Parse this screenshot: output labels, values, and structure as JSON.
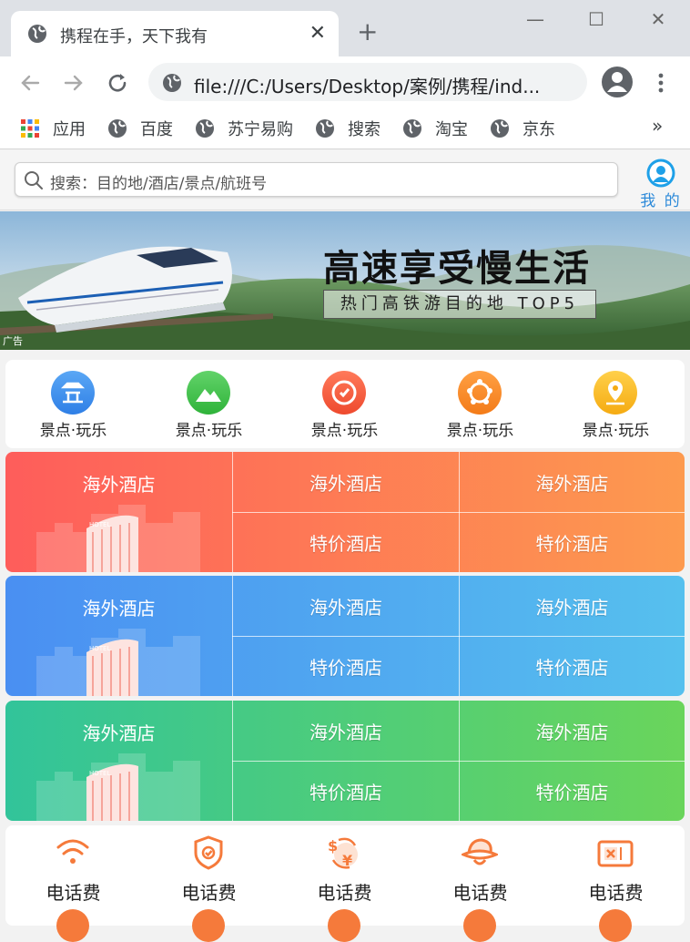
{
  "browser": {
    "tab_title": "携程在手，天下我有",
    "tab_close": "✕",
    "new_tab": "+",
    "window_controls": {
      "minimize": "—",
      "maximize": "☐",
      "close": "✕"
    },
    "url": "file:///C:/Users/Desktop/案例/携程/ind...",
    "bookmarks": [
      "应用",
      "百度",
      "苏宁易购",
      "搜索",
      "淘宝",
      "京东"
    ],
    "bookmarks_more": "»"
  },
  "page": {
    "search": {
      "placeholder": "搜索：目的地/酒店/景点/航班号"
    },
    "user": {
      "label": "我 的"
    },
    "banner": {
      "headline": "高速享受慢生活",
      "subline": "热门高铁游目的地 TOP5",
      "ad_tag": "广告"
    },
    "nav_items": [
      {
        "label": "景点·玩乐",
        "icon": "pagoda-icon",
        "color": "#3b8ff0"
      },
      {
        "label": "景点·玩乐",
        "icon": "mountain-icon",
        "color": "#3fbf3f"
      },
      {
        "label": "景点·玩乐",
        "icon": "refresh-badge-icon",
        "color": "#f0573b"
      },
      {
        "label": "景点·玩乐",
        "icon": "ferris-wheel-icon",
        "color": "#f58a1f"
      },
      {
        "label": "景点·玩乐",
        "icon": "location-pin-icon",
        "color": "#f7b718"
      }
    ],
    "hotel_blocks": [
      {
        "theme": "red",
        "main": "海外酒店",
        "cells": [
          "海外酒店",
          "海外酒店",
          "特价酒店",
          "特价酒店"
        ],
        "colors": [
          "#fe5d5b",
          "#fd9a4f"
        ]
      },
      {
        "theme": "blue",
        "main": "海外酒店",
        "cells": [
          "海外酒店",
          "海外酒店",
          "特价酒店",
          "特价酒店"
        ],
        "colors": [
          "#4a8ff2",
          "#56c0ee"
        ]
      },
      {
        "theme": "green",
        "main": "海外酒店",
        "cells": [
          "海外酒店",
          "海外酒店",
          "特价酒店",
          "特价酒店"
        ],
        "colors": [
          "#32c49a",
          "#6ad55b"
        ]
      }
    ],
    "utility_items": [
      {
        "label": "电话费",
        "icon": "wifi-icon"
      },
      {
        "label": "电话费",
        "icon": "shield-check-icon"
      },
      {
        "label": "电话费",
        "icon": "currency-exchange-icon"
      },
      {
        "label": "电话费",
        "icon": "hat-icon"
      },
      {
        "label": "电话费",
        "icon": "ticket-icon"
      }
    ],
    "accent_color": "#f57a3b"
  }
}
